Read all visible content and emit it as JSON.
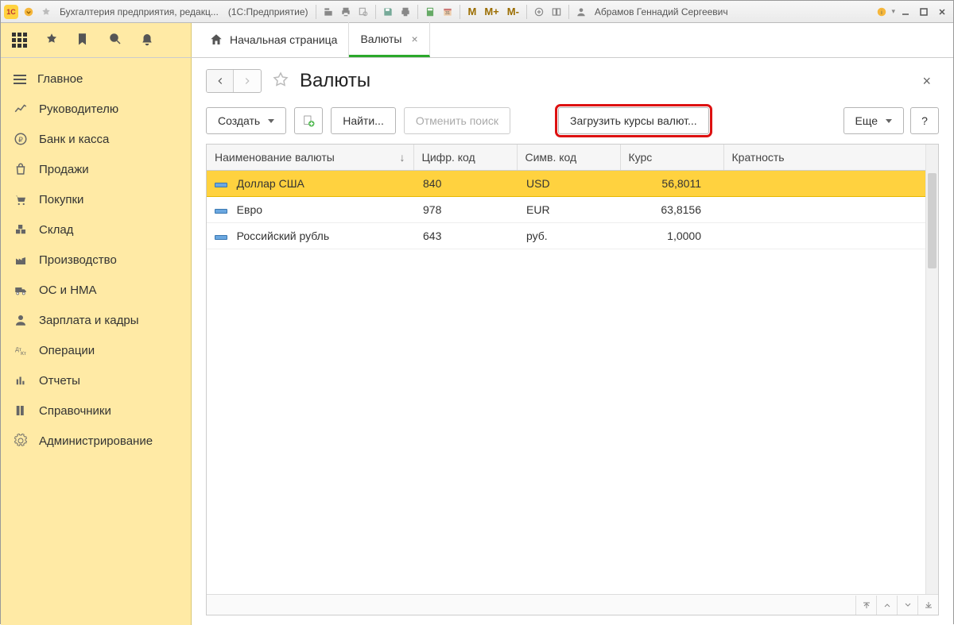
{
  "titlebar": {
    "app_title_left": "Бухгалтерия предприятия, редакц...",
    "app_title_paren": "(1С:Предприятие)",
    "user_name": "Абрамов Геннадий Сергеевич",
    "m_labels": [
      "M",
      "M+",
      "M-"
    ]
  },
  "tabs": {
    "home": "Начальная страница",
    "items": [
      {
        "label": "Валюты",
        "active": true
      }
    ]
  },
  "sidebar": {
    "items": [
      "Главное",
      "Руководителю",
      "Банк и касса",
      "Продажи",
      "Покупки",
      "Склад",
      "Производство",
      "ОС и НМА",
      "Зарплата и кадры",
      "Операции",
      "Отчеты",
      "Справочники",
      "Администрирование"
    ]
  },
  "page": {
    "title": "Валюты"
  },
  "toolbar": {
    "create": "Создать",
    "find": "Найти...",
    "cancel_search": "Отменить поиск",
    "load_rates": "Загрузить курсы валют...",
    "more": "Еще",
    "help": "?"
  },
  "table": {
    "columns": [
      "Наименование валюты",
      "Цифр. код",
      "Симв. код",
      "Курс",
      "Кратность"
    ],
    "rows": [
      {
        "name": "Доллар США",
        "num_code": "840",
        "sym_code": "USD",
        "rate": "56,8011",
        "mult": "",
        "selected": true
      },
      {
        "name": "Евро",
        "num_code": "978",
        "sym_code": "EUR",
        "rate": "63,8156",
        "mult": ""
      },
      {
        "name": "Российский рубль",
        "num_code": "643",
        "sym_code": "руб.",
        "rate": "1,0000",
        "mult": ""
      }
    ]
  }
}
